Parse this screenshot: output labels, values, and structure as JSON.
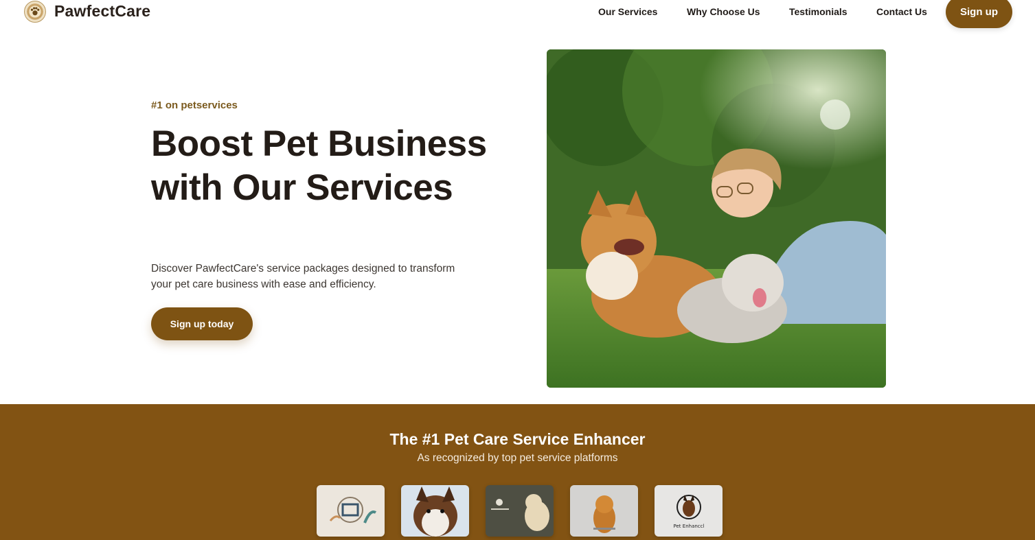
{
  "header": {
    "brand": "PawfectCare",
    "logo_icon": "paw-badge-icon",
    "nav": [
      "Our Services",
      "Why Choose Us",
      "Testimonials",
      "Contact Us"
    ],
    "signup_label": "Sign up"
  },
  "hero": {
    "eyebrow": "#1 on petservices",
    "headline": "Boost Pet Business with Our Services",
    "subcopy": "Discover PawfectCare's service packages designed to transform your pet care business with ease and efficiency.",
    "cta_label": "Sign up today",
    "image_icon": "woman-with-dogs-photo"
  },
  "band": {
    "title": "The #1 Pet Care Service Enhancer",
    "subtitle": "As recognized by top pet service platforms",
    "partner_logos": [
      {
        "icon": "partner-logo-1"
      },
      {
        "icon": "partner-logo-2"
      },
      {
        "icon": "partner-logo-3"
      },
      {
        "icon": "partner-logo-4"
      },
      {
        "icon": "partner-logo-5",
        "text": "Pet Enhanccl"
      }
    ]
  },
  "colors": {
    "brand_brown": "#7e5313",
    "band_brown": "#825313",
    "eyebrow": "#7b5a1e",
    "text_dark": "#231c17"
  }
}
